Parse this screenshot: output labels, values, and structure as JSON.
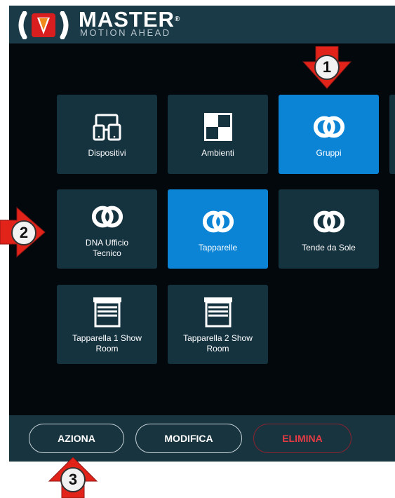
{
  "brand": {
    "name": "MASTER",
    "registered": "®",
    "tagline": "MOTION AHEAD"
  },
  "tiles": [
    {
      "label": "Dispositivi",
      "icon": "devices-icon",
      "active": false
    },
    {
      "label": "Ambienti",
      "icon": "rooms-icon",
      "active": false
    },
    {
      "label": "Gruppi",
      "icon": "groups-icon",
      "active": true
    },
    {
      "label": "DNA Ufficio Tecnico",
      "icon": "group-icon",
      "active": false
    },
    {
      "label": "Tapparelle",
      "icon": "group-icon",
      "active": true
    },
    {
      "label": "Tende da Sole",
      "icon": "group-icon",
      "active": false
    },
    {
      "label": "Tapparella 1 Show Room",
      "icon": "shutter-icon",
      "active": false
    },
    {
      "label": "Tapparella 2 Show Room",
      "icon": "shutter-icon",
      "active": false
    }
  ],
  "actions": {
    "aziona": "AZIONA",
    "modifica": "MODIFICA",
    "elimina": "ELIMINA"
  },
  "callouts": [
    "1",
    "2",
    "3"
  ],
  "colors": {
    "header": "#1b3a47",
    "tile": "#15323f",
    "active": "#0b84d6",
    "danger": "#e53b45",
    "callout_arrow": "#e2231a"
  }
}
